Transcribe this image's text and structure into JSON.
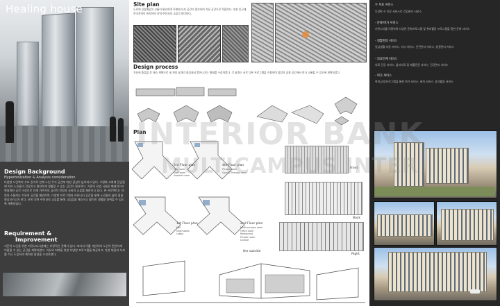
{
  "left": {
    "title": "Healing house",
    "background": {
      "heading": "Design Background",
      "subheading": "Hyperbolization & Analysis consideration",
      "text": "다양한 노인복지 수요 증가로 인해 노인 주거 공간에 대한 관심이 높아지고 있다. 고령화 사회에 진입함에 따라 노인들이 건강하고 편안하게 생활할 수 있는 공간이 필요하다. 기존의 요양 시설은 폐쇄적이고 획일화된 공간 구성으로 인해 거주자의 심리적 안정과 사회적 교류를 제한하고 있다. 본 프로젝트는 자연과 소통하는 치유의 공간을 제안하며, 다양한 프로그램과 커뮤니티 공간을 통해 노인들의 삶의 질을 향상시키고자 한다. 또한 지역 주민과의 교류를 통해 고립감을 해소하고 활기찬 생활을 영위할 수 있도록 계획하였다."
    },
    "requirement": {
      "heading": "Requirement &",
      "heading2": "Improvement",
      "text": "기존의 노인을 위한 커뮤니티시설에는 부정적인 견해가 있다. 따라서 이를 개선하여 노인이 편안하게 이용할 수 있는 공간을 계획하였다. 치유와 회복을 위한 다양한 프로그램을 제공하고, 자연 채광과 녹지를 적극 도입하여 쾌적한 환경을 조성하였다."
    }
  },
  "site": {
    "heading": "Site plan",
    "text": "도로에 인접해있어 교통이 편리하며 주변에 녹지 공간이 풍부하여 치유 공간으로 적합하다. 또한 인근에 주거지역이 위치하여 지역 주민과의 교류가 용이하다."
  },
  "process": {
    "heading": "Design process",
    "text": "치유에 중점을 둔 매스 계획으로 세 개의 날개가 중심에서 뻗어나가는 형태를 구성하였다. 각 날개는 서로 다른 프로그램을 수용하며 중앙의 공용 공간에서 만나 소통할 수 있도록 계획하였다."
  },
  "plan": {
    "heading": "Plan",
    "floors": [
      {
        "label": "3rd Floor plan",
        "rooms": [
          "Day room",
          "Staff room",
          "Hospital room"
        ]
      },
      {
        "label": "4th Floor plan",
        "rooms": [
          "Private room",
          "Gym & Therapy room"
        ]
      },
      {
        "label": "1st Floor plan",
        "rooms": [
          "Hall",
          "Information",
          "Lobby"
        ]
      },
      {
        "label": "2nd Floor plan",
        "rooms": [
          "Multi-purpose room",
          "Office room",
          "Restaurant",
          "Private room",
          "Lounge"
        ]
      }
    ],
    "elev_labels": [
      "Front",
      "Back",
      "Right"
    ],
    "outside_label": "the outside"
  },
  "services": {
    "heading": "수 치료 서비스",
    "intro": "다양한 수 치료 서비스로 건강관리 서비스.",
    "items": [
      {
        "title": "- 문화/여가 서비스",
        "desc": "커뮤니티를 이용하여 다양한 문화프로그램 및 취미활동 프로그램을 통한 문화 서비스"
      },
      {
        "title": "- 생활편의 서비스",
        "desc": "일상생활 지원 서비스, 식사 서비스, 안전관리 서비스, 청결관리 서비스"
      },
      {
        "title": "- 의료연계 서비스",
        "desc": "의료 건강 서비스, 물리치료 및 재활운동 서비스, 건강관리 서비스"
      },
      {
        "title": "- 여가 서비스",
        "desc": "취미/교양프로그램을 통한 여가 서비스, 레저 서비스, 휴식활동 서비스"
      }
    ]
  },
  "watermark": {
    "line1": "INTERIOR BANK",
    "line2": "MULTICAMPUS INTER"
  },
  "colors": {
    "dark_panel": "#262626",
    "left_panel": "#3d3d3d"
  }
}
